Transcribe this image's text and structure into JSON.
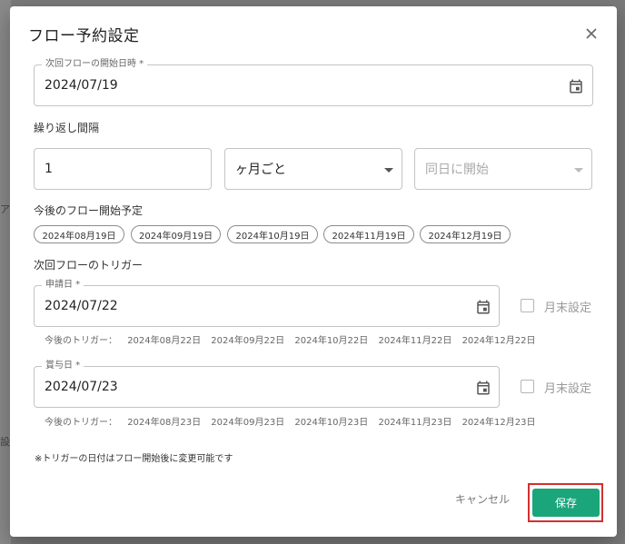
{
  "dialog": {
    "title": "フロー予約設定"
  },
  "next_start": {
    "label": "次回フローの開始日時 *",
    "value": "2024/07/19"
  },
  "repeat": {
    "section_label": "繰り返し間隔",
    "interval_value": "1",
    "unit_value": "ヶ月ごと",
    "day_placeholder": "同日に開始"
  },
  "upcoming": {
    "section_label": "今後のフロー開始予定",
    "dates": [
      "2024年08月19日",
      "2024年09月19日",
      "2024年10月19日",
      "2024年11月19日",
      "2024年12月19日"
    ]
  },
  "triggers": {
    "section_label": "次回フローのトリガー",
    "application": {
      "label": "申請日 *",
      "value": "2024/07/22",
      "month_end_label": "月末設定",
      "month_end_checked": false,
      "upcoming_prefix": "今後のトリガー：",
      "upcoming_dates": [
        "2024年08月22日",
        "2024年09月22日",
        "2024年10月22日",
        "2024年11月22日",
        "2024年12月22日"
      ]
    },
    "bonus": {
      "label": "賞与日 *",
      "value": "2024/07/23",
      "month_end_label": "月末設定",
      "month_end_checked": false,
      "upcoming_prefix": "今後のトリガー：",
      "upcoming_dates": [
        "2024年08月23日",
        "2024年09月23日",
        "2024年10月23日",
        "2024年11月23日",
        "2024年12月23日"
      ]
    }
  },
  "note": "※トリガーの日付はフロー開始後に変更可能です",
  "actions": {
    "cancel_label": "キャンセル",
    "save_label": "保存"
  },
  "backdrop": {
    "glyphs": [
      "ア",
      "設"
    ]
  },
  "colors": {
    "primary": "#1ba57a",
    "highlight": "#d32f2f",
    "overlay": "#7a7a7a"
  },
  "icons": {
    "close": "close-icon",
    "calendar": "calendar-icon",
    "dropdown": "chevron-down-icon"
  }
}
